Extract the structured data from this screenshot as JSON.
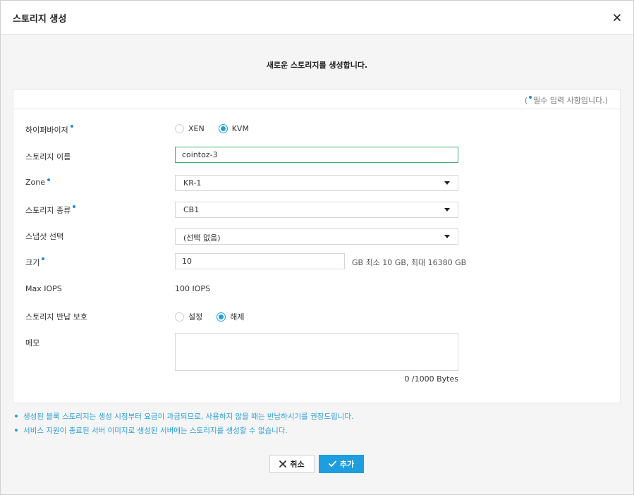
{
  "dialog": {
    "title": "스토리지 생성",
    "subtitle": "새로운 스토리지를 생성합니다."
  },
  "required_note": {
    "open": "(",
    "text": "필수 입력 사항입니다.)"
  },
  "form": {
    "hypervisor": {
      "label": "하이퍼바이저",
      "options": [
        "XEN",
        "KVM"
      ],
      "selected": "KVM"
    },
    "storage_name": {
      "label": "스토리지 이름",
      "value": "cointoz-3"
    },
    "zone": {
      "label": "Zone",
      "selected": "KR-1"
    },
    "storage_type": {
      "label": "스토리지 종류",
      "selected": "CB1"
    },
    "snapshot": {
      "label": "스냅샷 선택",
      "selected": "(선택 없음)"
    },
    "size": {
      "label": "크기",
      "value": "10",
      "hint": "GB  최소 10 GB, 최대 16380 GB"
    },
    "max_iops": {
      "label": "Max IOPS",
      "value": "100 IOPS"
    },
    "return_protection": {
      "label": "스토리지 반납 보호",
      "options": [
        "설정",
        "해제"
      ],
      "selected": "해제"
    },
    "memo": {
      "label": "메모",
      "value": "",
      "counter": "0 /1000 Bytes"
    }
  },
  "notes": [
    "생성된 블록 스토리지는 생성 시점부터 요금이 과금되므로, 사용하지 않을 때는 반납하시기를 권장드립니다.",
    "서비스 지원이 종료된 서버 이미지로 생성된 서버에는 스토리지를 생성할 수 없습니다."
  ],
  "buttons": {
    "cancel": "취소",
    "add": "추가"
  },
  "colors": {
    "accent": "#1e9ee0",
    "required_dot": "#1e88e5",
    "note_text": "#2a9fd6",
    "active_border": "#3cb371"
  }
}
